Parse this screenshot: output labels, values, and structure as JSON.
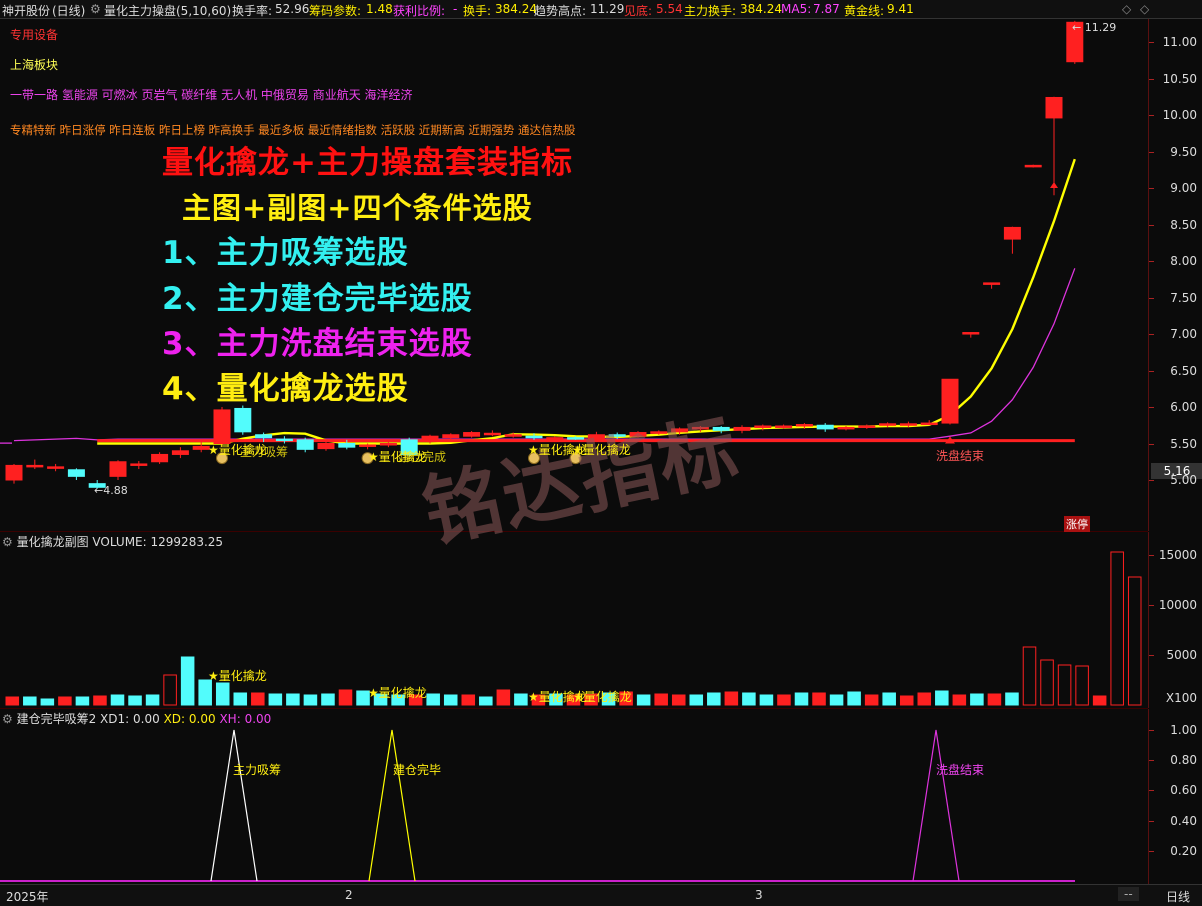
{
  "header": {
    "stock_name": "神开股份",
    "period": "(日线)",
    "indicator": "量化主力操盘(5,10,60)",
    "turnover_label": "换手率:",
    "turnover_value": "52.96",
    "chips_label": "筹码参数:",
    "chips_value": "1.48",
    "profit_label": "获利比例:",
    "profit_value": "-",
    "hand_label": "换手:",
    "hand_value": "384.24",
    "trend_high_label": "趋势高点:",
    "trend_high_value": "11.29",
    "low_label": "见底:",
    "low_value": "5.54",
    "main_hand_label": "主力换手:",
    "main_hand_value": "384.24",
    "ma5_label": "MA5:",
    "ma5_value": "7.87",
    "gold_label": "黄金线:",
    "gold_value": "9.41"
  },
  "main_panel": {
    "tag_special": "专用设备",
    "tag_region": "上海板块",
    "concepts": "一带一路 氢能源 可燃冰 页岩气 碳纤维 无人机 中俄贸易 商业航天 海洋经济",
    "hot_tags": "专精特新 昨日涨停 昨日连板 昨日上榜 昨高换手 最近多板 最近情绪指数 活跃股 近期新高 近期强势 通达信热股",
    "promo_title": "量化擒龙+主力操盘套装指标",
    "promo_sub": "主图+副图+四个条件选股",
    "promo_line1": "1、主力吸筹选股",
    "promo_line2": "2、主力建仓完毕选股",
    "promo_line3": "3、主力洗盘结束选股",
    "promo_line4": "4、量化擒龙选股",
    "watermark": "铭达指标",
    "low_marker": "←4.88",
    "high_marker": "← 11.29",
    "price_now": "5.16",
    "signal_a": "★量化擒龙",
    "signal_a2": "主力吸筹",
    "signal_b": "★量化擒龙",
    "signal_b2": "建仓完成",
    "signal_c": "★量化擒龙",
    "signal_d": "★量化擒龙",
    "wash_end": "洗盘结束",
    "limit_up": "涨停",
    "price_ticks": [
      "11.00",
      "10.50",
      "10.00",
      "9.50",
      "9.00",
      "8.50",
      "8.00",
      "7.50",
      "7.00",
      "6.50",
      "6.00",
      "5.50",
      "5.00"
    ]
  },
  "volume_panel": {
    "title": "量化擒龙副图 VOLUME:",
    "value": "1299283.25",
    "signal_a": "★量化擒龙",
    "signal_b": "★量化擒龙",
    "signal_c": "★量化擒龙",
    "signal_d": "★量化擒龙",
    "ticks": [
      "15000",
      "10000",
      "5000"
    ],
    "unit": "X100",
    "volumes": [
      8,
      8,
      6,
      8,
      8,
      9,
      10,
      9,
      10,
      30,
      48,
      25,
      22,
      12,
      12,
      11,
      11,
      10,
      11,
      15,
      14,
      11,
      10,
      10,
      11,
      10,
      10,
      8,
      15,
      11,
      10,
      11,
      10,
      11,
      12,
      13,
      10,
      11,
      10,
      10,
      12,
      13,
      12,
      10,
      10,
      12,
      12,
      10,
      13,
      10,
      12,
      9,
      12,
      14,
      10,
      11,
      11,
      12,
      58,
      45,
      40,
      39,
      9,
      153,
      128
    ],
    "up": [
      true,
      false,
      false,
      true,
      false,
      true,
      false,
      false,
      false,
      true,
      false,
      false,
      false,
      false,
      true,
      false,
      false,
      false,
      false,
      true,
      false,
      false,
      false,
      true,
      false,
      false,
      true,
      false,
      true,
      false,
      true,
      false,
      true,
      true,
      false,
      true,
      false,
      true,
      true,
      false,
      false,
      true,
      false,
      false,
      true,
      false,
      true,
      false,
      false,
      true,
      false,
      true,
      true,
      false,
      true,
      false,
      true,
      false,
      true,
      true,
      true,
      true,
      true,
      true,
      true
    ]
  },
  "cond_panel": {
    "title": "建仓完毕吸筹2",
    "xd1_label": "XD1:",
    "xd1_value": "0.00",
    "xd_label": "XD:",
    "xd_value": "0.00",
    "xh_label": "XH:",
    "xh_value": "0.00",
    "peak1_label": "主力吸筹",
    "peak2_label": "建仓完毕",
    "peak3_label": "洗盘结束",
    "ticks": [
      "1.00",
      "0.80",
      "0.60",
      "0.40",
      "0.20"
    ]
  },
  "footer": {
    "year": "2025年",
    "m2": "2",
    "m3": "3",
    "scroll_btn": "--",
    "period_btn": "日线"
  },
  "colors": {
    "up": "#ff2020",
    "down": "#52fcfc",
    "yellow": "#ffff00",
    "magenta": "#dd33dd"
  },
  "candles": [
    [
      5.0,
      5.2,
      4.95,
      5.22
    ],
    [
      5.18,
      5.2,
      5.15,
      5.28
    ],
    [
      5.16,
      5.18,
      5.12,
      5.22
    ],
    [
      5.14,
      5.05,
      5.0,
      5.16
    ],
    [
      4.95,
      4.9,
      4.88,
      5.0
    ],
    [
      5.05,
      5.25,
      5.0,
      5.27
    ],
    [
      5.2,
      5.22,
      5.15,
      5.26
    ],
    [
      5.25,
      5.35,
      5.22,
      5.38
    ],
    [
      5.35,
      5.4,
      5.3,
      5.45
    ],
    [
      5.42,
      5.46,
      5.38,
      5.52
    ],
    [
      5.5,
      5.96,
      5.48,
      6.0
    ],
    [
      5.98,
      5.66,
      5.62,
      6.02
    ],
    [
      5.62,
      5.58,
      5.52,
      5.65
    ],
    [
      5.56,
      5.55,
      5.5,
      5.6
    ],
    [
      5.55,
      5.42,
      5.38,
      5.58
    ],
    [
      5.43,
      5.5,
      5.4,
      5.52
    ],
    [
      5.5,
      5.45,
      5.42,
      5.55
    ],
    [
      5.46,
      5.48,
      5.42,
      5.5
    ],
    [
      5.48,
      5.5,
      5.45,
      5.52
    ],
    [
      5.55,
      5.35,
      5.32,
      5.58
    ],
    [
      5.55,
      5.6,
      5.5,
      5.62
    ],
    [
      5.58,
      5.62,
      5.55,
      5.64
    ],
    [
      5.6,
      5.65,
      5.58,
      5.67
    ],
    [
      5.63,
      5.64,
      5.6,
      5.68
    ],
    [
      5.62,
      5.62,
      5.58,
      5.65
    ],
    [
      5.6,
      5.58,
      5.55,
      5.64
    ],
    [
      5.56,
      5.58,
      5.52,
      5.6
    ],
    [
      5.58,
      5.57,
      5.55,
      5.6
    ],
    [
      5.55,
      5.62,
      5.52,
      5.66
    ],
    [
      5.62,
      5.6,
      5.56,
      5.65
    ],
    [
      5.6,
      5.65,
      5.58,
      5.67
    ],
    [
      5.65,
      5.66,
      5.62,
      5.68
    ],
    [
      5.66,
      5.7,
      5.62,
      5.72
    ],
    [
      5.7,
      5.72,
      5.66,
      5.74
    ],
    [
      5.72,
      5.68,
      5.64,
      5.74
    ],
    [
      5.68,
      5.72,
      5.64,
      5.75
    ],
    [
      5.72,
      5.74,
      5.68,
      5.76
    ],
    [
      5.73,
      5.74,
      5.7,
      5.76
    ],
    [
      5.74,
      5.76,
      5.7,
      5.78
    ],
    [
      5.75,
      5.7,
      5.66,
      5.78
    ],
    [
      5.7,
      5.72,
      5.68,
      5.74
    ],
    [
      5.72,
      5.74,
      5.7,
      5.76
    ],
    [
      5.75,
      5.77,
      5.72,
      5.79
    ],
    [
      5.76,
      5.77,
      5.72,
      5.8
    ],
    [
      5.77,
      5.78,
      5.75,
      5.82
    ],
    [
      5.78,
      6.38,
      5.76,
      6.38
    ],
    [
      7.0,
      7.02,
      6.95,
      7.02
    ],
    [
      7.68,
      7.7,
      7.62,
      7.7
    ],
    [
      8.3,
      8.46,
      8.1,
      8.47
    ],
    [
      9.3,
      9.31,
      9.28,
      9.32
    ],
    [
      9.96,
      10.24,
      8.9,
      10.25
    ],
    [
      10.73,
      11.27,
      10.7,
      11.29
    ]
  ]
}
